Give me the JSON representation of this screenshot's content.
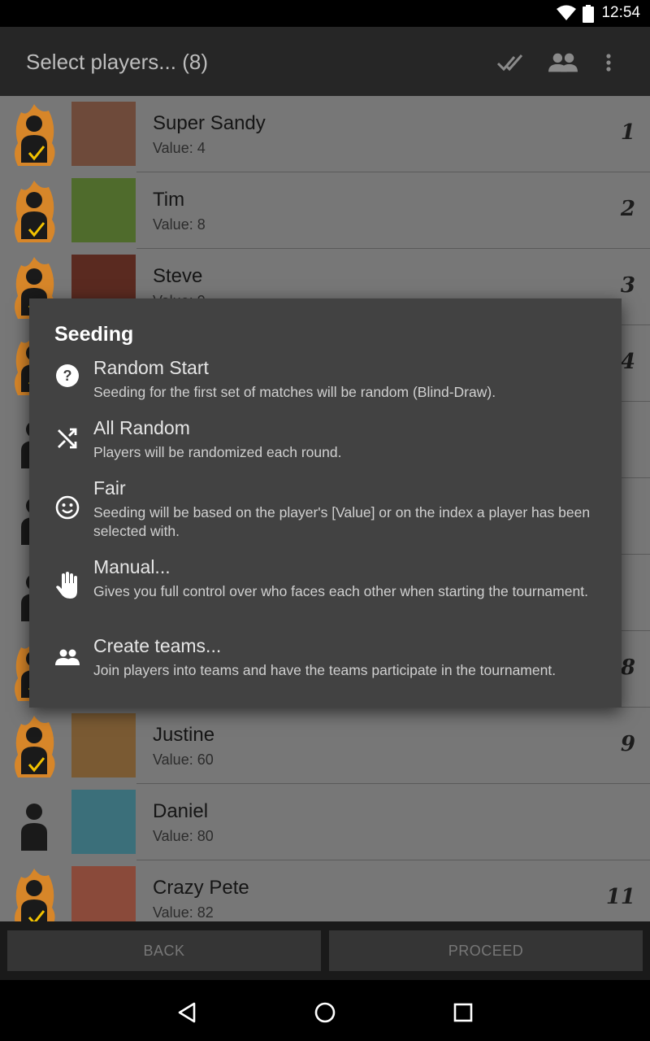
{
  "status_bar": {
    "time": "12:54",
    "wifi_icon": "wifi-icon",
    "battery_icon": "battery-icon"
  },
  "app_bar": {
    "title": "Select players... (8)",
    "actions": [
      "select-all-icon",
      "people-icon",
      "more-vert-icon"
    ]
  },
  "players": [
    {
      "name": "Super Sandy",
      "value": "Value: 4",
      "index": "1",
      "selected": true,
      "photo_color": "#6e4a3a"
    },
    {
      "name": "Tim",
      "value": "Value: 8",
      "index": "2",
      "selected": true,
      "photo_color": "#4f6b2c"
    },
    {
      "name": "Steve",
      "value": "Value: 9",
      "index": "3",
      "selected": true,
      "photo_color": "#5a2a20"
    },
    {
      "name": "",
      "value": "",
      "index": "4",
      "selected": true,
      "photo_color": "#555555"
    },
    {
      "name": "",
      "value": "",
      "index": "",
      "selected": false,
      "photo_color": "#555555"
    },
    {
      "name": "",
      "value": "",
      "index": "",
      "selected": false,
      "photo_color": "#555555"
    },
    {
      "name": "",
      "value": "",
      "index": "",
      "selected": false,
      "photo_color": "#555555"
    },
    {
      "name": "",
      "value": "",
      "index": "8",
      "selected": true,
      "photo_color": "#555555"
    },
    {
      "name": "Justine",
      "value": "Value: 60",
      "index": "9",
      "selected": true,
      "photo_color": "#7a5a33"
    },
    {
      "name": "Daniel",
      "value": "Value: 80",
      "index": "",
      "selected": false,
      "photo_color": "#3b6f7a"
    },
    {
      "name": "Crazy Pete",
      "value": "Value: 82",
      "index": "11",
      "selected": true,
      "photo_color": "#8a4a3a"
    }
  ],
  "bottom_buttons": {
    "back": "BACK",
    "proceed": "PROCEED"
  },
  "dialog": {
    "title": "Seeding",
    "options": [
      {
        "label": "Random Start",
        "description": "Seeding for the first set of matches will be random (Blind-Draw).",
        "icon": "help-circle-icon"
      },
      {
        "label": "All Random",
        "description": "Players will be randomized each round.",
        "icon": "shuffle-icon"
      },
      {
        "label": "Fair",
        "description": "Seeding will be based on the player's [Value] or on the index a player has been selected with.",
        "icon": "smiley-icon"
      },
      {
        "label": "Manual...",
        "description": "Gives you full control over who faces each other when starting the tournament.",
        "icon": "hand-icon"
      },
      {
        "label": "Create teams...",
        "description": "Join players into teams and have the teams participate in the tournament.",
        "icon": "group-icon"
      }
    ]
  },
  "colors": {
    "accent_flame": "#e8881b",
    "check": "#f2c200",
    "dialog_bg": "#424242",
    "app_bar_bg": "#262626"
  }
}
